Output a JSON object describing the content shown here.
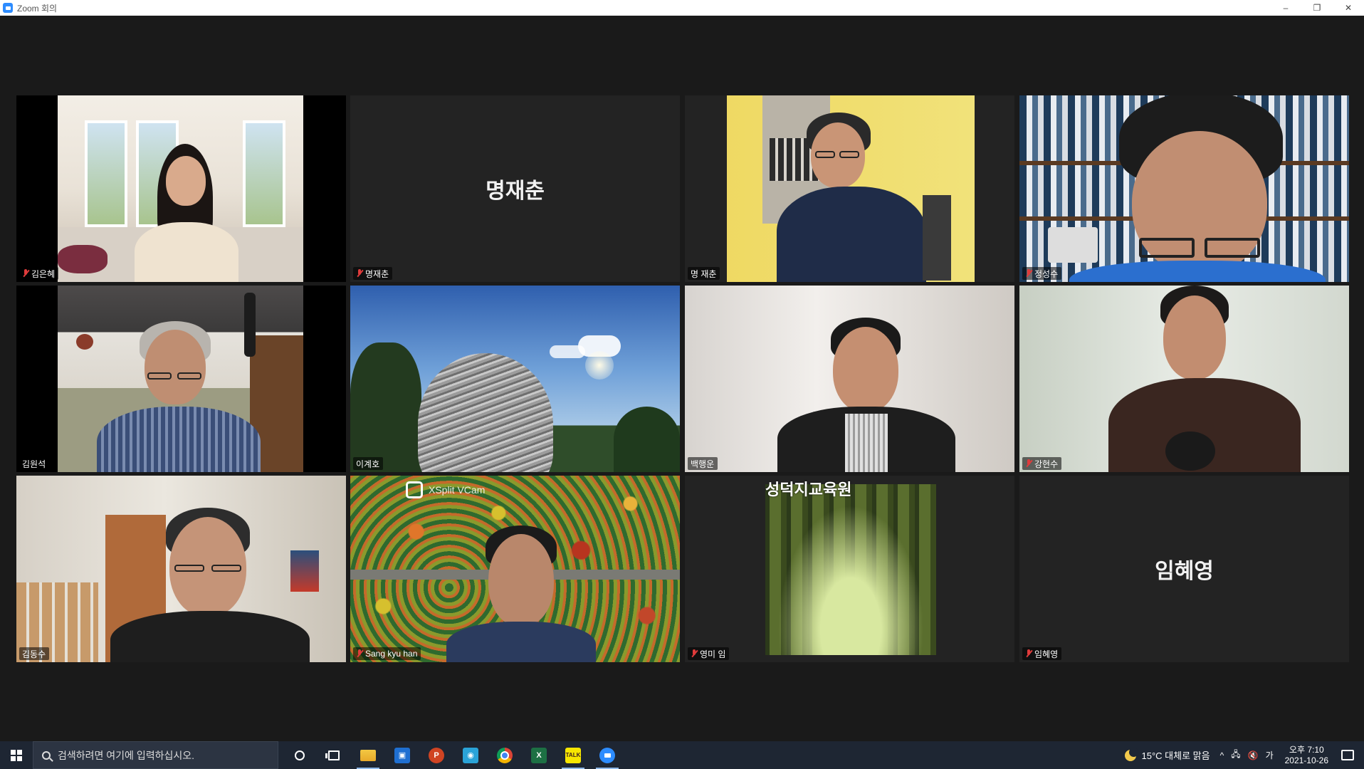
{
  "window": {
    "title": "Zoom 회의",
    "minimize": "–",
    "restore": "❐",
    "close": "✕"
  },
  "participants": [
    {
      "name": "김은혜",
      "muted": true
    },
    {
      "name": "명재춘",
      "muted": true,
      "display_name": "명재춘"
    },
    {
      "name": "명 재춘",
      "muted": false
    },
    {
      "name": "정성수",
      "muted": true
    },
    {
      "name": "김원석",
      "muted": false
    },
    {
      "name": "이계호",
      "muted": false
    },
    {
      "name": "백행운",
      "muted": false,
      "active_speaker": true
    },
    {
      "name": "강현수",
      "muted": true
    },
    {
      "name": "김동수",
      "muted": false
    },
    {
      "name": "Sang kyu han",
      "muted": true,
      "overlay": "XSplit VCam"
    },
    {
      "name": "영미 임",
      "muted": true,
      "overlay": "성덕지교육원"
    },
    {
      "name": "임혜영",
      "muted": true,
      "display_name": "임혜영"
    }
  ],
  "taskbar": {
    "search_placeholder": "검색하려면 여기에 입력하십시오.",
    "apps": [
      "file-explorer",
      "microsoft-store",
      "powerpoint",
      "camera",
      "chrome",
      "excel",
      "kakaotalk",
      "zoom"
    ],
    "kakao_label": "TALK",
    "weather": "15°C  대체로 맑음",
    "tray_up": "^",
    "volume": "🔇",
    "ime": "가",
    "time": "오후 7:10",
    "date": "2021-10-26"
  },
  "colors": {
    "active_speaker_border": "#d7e56a",
    "mute_red": "#e03b3b",
    "taskbar": "#1e2633"
  }
}
